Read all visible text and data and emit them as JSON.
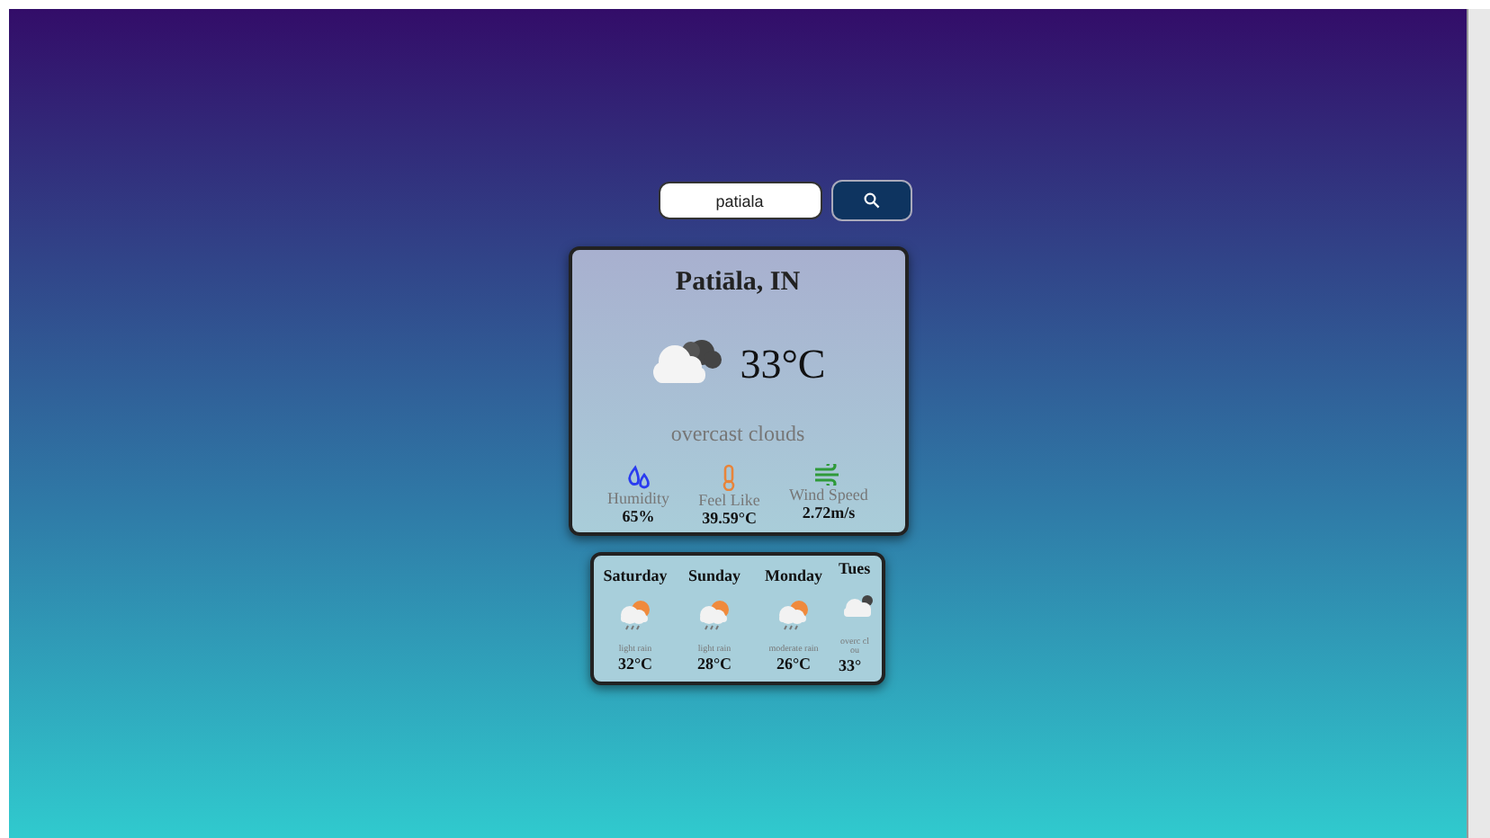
{
  "search": {
    "value": "patiala"
  },
  "current": {
    "city": "Patiāla, IN",
    "temperature": "33°C",
    "description": "overcast clouds",
    "stats": [
      {
        "kind": "humidity",
        "label": "Humidity",
        "value": "65%"
      },
      {
        "kind": "feel",
        "label": "Feel Like",
        "value": "39.59°C"
      },
      {
        "kind": "wind",
        "label": "Wind Speed",
        "value": "2.72m/s"
      }
    ]
  },
  "forecast": [
    {
      "day": "Saturday",
      "kind": "rain",
      "description": "light rain",
      "temperature": "32°C"
    },
    {
      "day": "Sunday",
      "kind": "rain",
      "description": "light rain",
      "temperature": "28°C"
    },
    {
      "day": "Monday",
      "kind": "rain",
      "description": "moderate rain",
      "temperature": "26°C"
    },
    {
      "day": "Tues",
      "kind": "clouds",
      "description": "overc clou",
      "temperature": "33°"
    }
  ]
}
